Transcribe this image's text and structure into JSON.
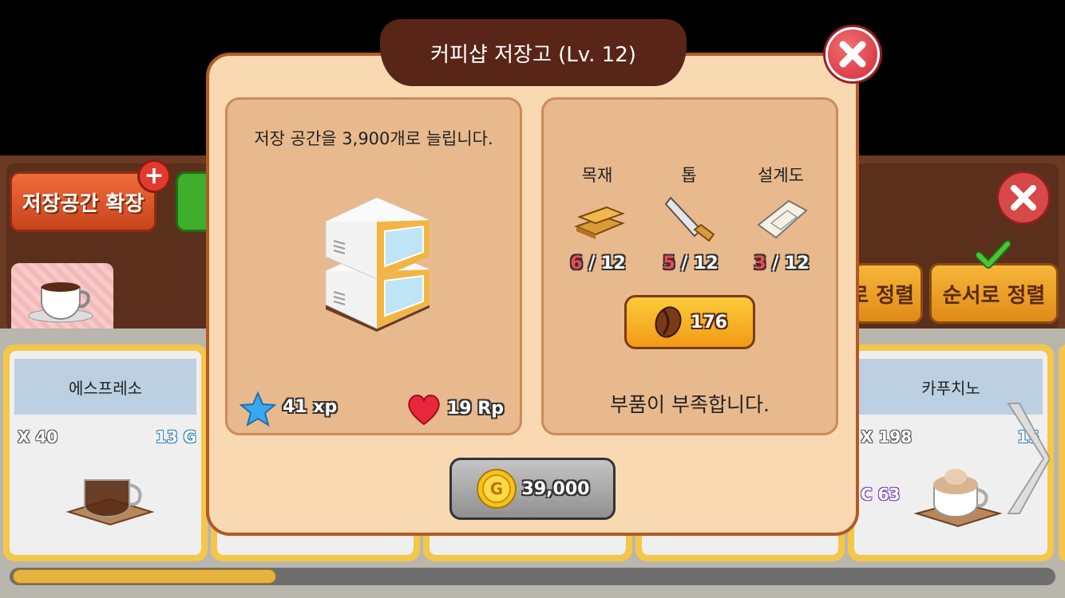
{
  "modal": {
    "title": "커피샵 저장고 (Lv. 12)",
    "description": "저장 공간을 3,900개로 늘립니다.",
    "xp_label": "41 xp",
    "rp_label": "19 Rp",
    "materials": [
      {
        "name": "목재",
        "have": "6",
        "need": "/ 12",
        "icon": "wood-planks-icon"
      },
      {
        "name": "톱",
        "have": "5",
        "need": "/ 12",
        "icon": "saw-icon"
      },
      {
        "name": "설계도",
        "have": "3",
        "need": "/ 12",
        "icon": "blueprint-icon"
      }
    ],
    "bean_cost": "176",
    "shortage_message": "부품이 부족합니다.",
    "gold_cost": "39,000"
  },
  "background": {
    "expand_button_label": "저장공간 확장",
    "sort_button_partial": "로 정렬",
    "sort_button_label": "순서로 정렬",
    "cards": [
      {
        "name": "에스프레소",
        "quantity": "X 40",
        "price": "13 G"
      },
      {
        "name": "카푸치노",
        "quantity": "X 198",
        "price": "15",
        "extra": "C 63"
      }
    ]
  },
  "colors": {
    "modal_bg": "#f8d9b2",
    "title_bar": "#582517",
    "close_red": "#d42b3a",
    "bean_button": "#f29a18",
    "material_have": "#f04a50"
  }
}
